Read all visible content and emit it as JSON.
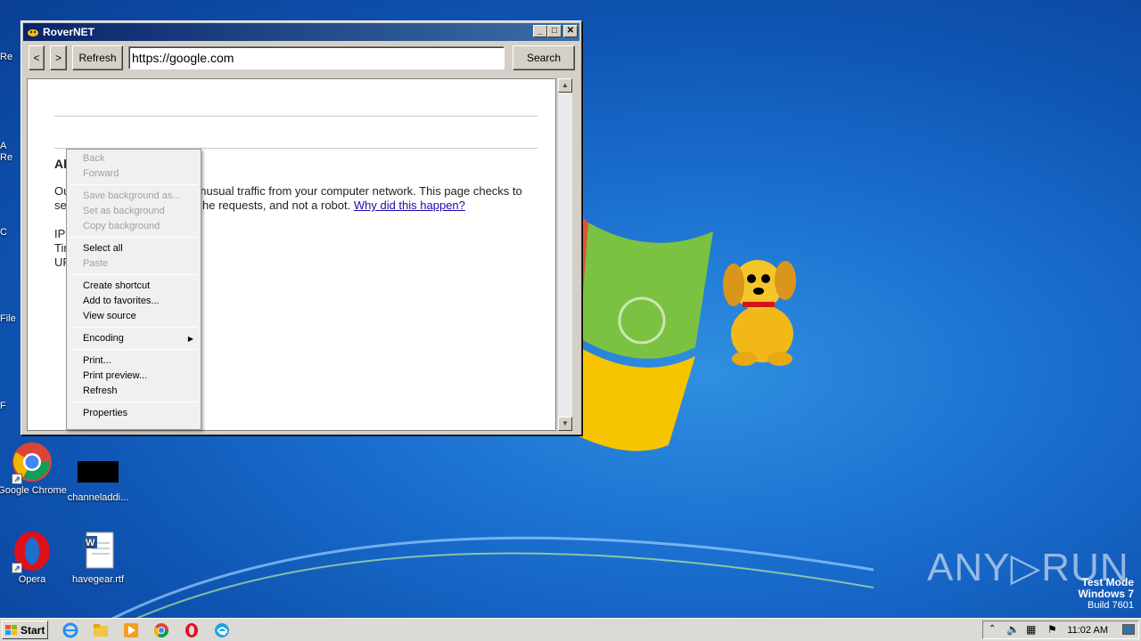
{
  "desktop": {
    "icons": [
      {
        "label": "Google Chrome",
        "icon": "chrome-icon"
      },
      {
        "label": "channeladdi...",
        "icon": "black-image-icon"
      },
      {
        "label": "Opera",
        "icon": "opera-icon"
      },
      {
        "label": "havegear.rtf",
        "icon": "word-document-icon"
      }
    ],
    "left_stubs": [
      "Re",
      "A",
      "Re",
      "C",
      "File",
      "F"
    ]
  },
  "window": {
    "title": "RoverNET",
    "buttons": {
      "minimize": "_",
      "maximize": "□",
      "close": "✕"
    },
    "toolbar": {
      "back": "<",
      "forward": ">",
      "refresh": "Refresh",
      "url": "https://google.com",
      "search": "Search"
    },
    "page": {
      "heading": "Ab",
      "line1_left": "Ou",
      "line1_right": "unusual traffic from your computer network. This page checks to",
      "line2_left": "se",
      "line2_right": "he requests, and not a robot.",
      "link": "Why did this happen?",
      "ip": "IP",
      "time": "Tir",
      "url": "UF"
    }
  },
  "context_menu": {
    "groups": [
      [
        {
          "label": "Back",
          "enabled": false
        },
        {
          "label": "Forward",
          "enabled": false
        }
      ],
      [
        {
          "label": "Save background as...",
          "enabled": false
        },
        {
          "label": "Set as background",
          "enabled": false
        },
        {
          "label": "Copy background",
          "enabled": false
        }
      ],
      [
        {
          "label": "Select all",
          "enabled": true
        },
        {
          "label": "Paste",
          "enabled": false
        }
      ],
      [
        {
          "label": "Create shortcut",
          "enabled": true
        },
        {
          "label": "Add to favorites...",
          "enabled": true
        },
        {
          "label": "View source",
          "enabled": true
        }
      ],
      [
        {
          "label": "Encoding",
          "enabled": true,
          "submenu": true
        }
      ],
      [
        {
          "label": "Print...",
          "enabled": true
        },
        {
          "label": "Print preview...",
          "enabled": true
        },
        {
          "label": "Refresh",
          "enabled": true
        }
      ],
      [
        {
          "label": "Properties",
          "enabled": true
        }
      ]
    ]
  },
  "taskbar": {
    "start": "Start",
    "pinned": [
      "internet-explorer-icon",
      "folder-icon",
      "media-player-icon",
      "chrome-icon",
      "opera-icon",
      "edge-icon"
    ],
    "clock": "11:02 AM"
  },
  "watermark": {
    "line1": "Test Mode",
    "line2": "Windows 7",
    "line3": "Build 7601",
    "brand": "ANY▷RUN"
  },
  "colors": {
    "titlebar_start": "#0a246a",
    "titlebar_end": "#3a6ea5",
    "link": "#1a0dab",
    "desktop": "#1a6fcf"
  }
}
